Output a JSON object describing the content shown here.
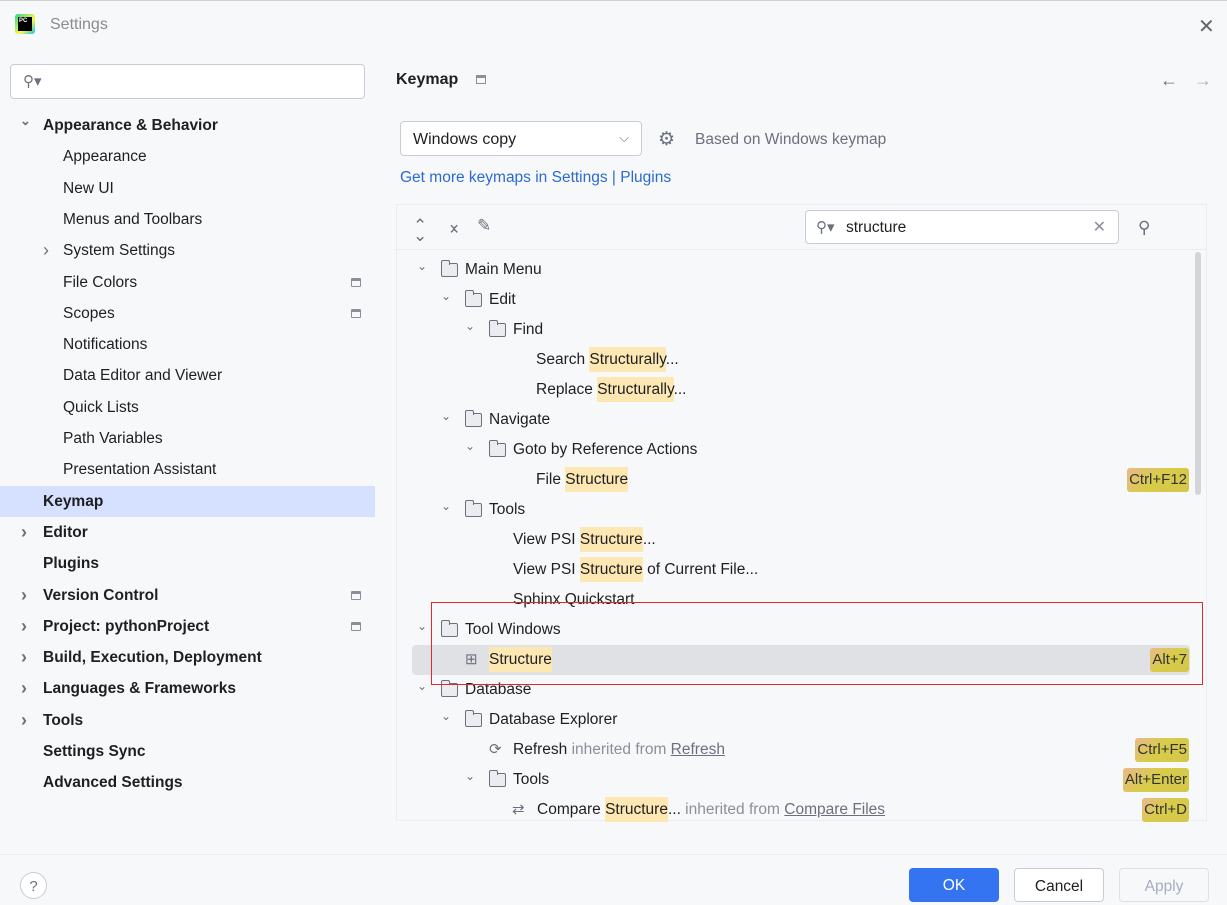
{
  "window": {
    "title": "Settings",
    "logo_text": "PC"
  },
  "sidebar": {
    "search_placeholder": "",
    "items": [
      {
        "label": "Appearance & Behavior",
        "level": 0,
        "bold": true,
        "chevron": "down"
      },
      {
        "label": "Appearance",
        "level": 1
      },
      {
        "label": "New UI",
        "level": 1
      },
      {
        "label": "Menus and Toolbars",
        "level": 1
      },
      {
        "label": "System Settings",
        "level": 1,
        "chevron": "right"
      },
      {
        "label": "File Colors",
        "level": 1,
        "pin": true
      },
      {
        "label": "Scopes",
        "level": 1,
        "pin": true
      },
      {
        "label": "Notifications",
        "level": 1
      },
      {
        "label": "Data Editor and Viewer",
        "level": 1
      },
      {
        "label": "Quick Lists",
        "level": 1
      },
      {
        "label": "Path Variables",
        "level": 1
      },
      {
        "label": "Presentation Assistant",
        "level": 1
      },
      {
        "label": "Keymap",
        "level": 0,
        "bold": true,
        "selected": true
      },
      {
        "label": "Editor",
        "level": 0,
        "bold": true,
        "chevron": "right"
      },
      {
        "label": "Plugins",
        "level": 0,
        "bold": true
      },
      {
        "label": "Version Control",
        "level": 0,
        "bold": true,
        "chevron": "right",
        "pin": true
      },
      {
        "label": "Project: pythonProject",
        "level": 0,
        "bold": true,
        "chevron": "right",
        "pin": true
      },
      {
        "label": "Build, Execution, Deployment",
        "level": 0,
        "bold": true,
        "chevron": "right"
      },
      {
        "label": "Languages & Frameworks",
        "level": 0,
        "bold": true,
        "chevron": "right"
      },
      {
        "label": "Tools",
        "level": 0,
        "bold": true,
        "chevron": "right"
      },
      {
        "label": "Settings Sync",
        "level": 0,
        "bold": true
      },
      {
        "label": "Advanced Settings",
        "level": 0,
        "bold": true
      }
    ]
  },
  "keymap": {
    "title": "Keymap",
    "selected_keymap": "Windows copy",
    "based_on": "Based on Windows keymap",
    "more_link": "Get more keymaps in Settings | Plugins",
    "filter_value": "structure",
    "icons": {
      "expand_all": "expand-all-icon",
      "collapse_all": "collapse-all-icon",
      "edit": "pencil-icon",
      "find_shortcut": "find-by-shortcut-icon"
    },
    "tree": [
      {
        "indent": 0,
        "chevron": true,
        "icon": "folder",
        "segments": [
          {
            "t": "Main Menu"
          }
        ]
      },
      {
        "indent": 1,
        "chevron": true,
        "icon": "folder",
        "segments": [
          {
            "t": "Edit"
          }
        ]
      },
      {
        "indent": 2,
        "chevron": true,
        "icon": "folder",
        "segments": [
          {
            "t": "Find"
          }
        ]
      },
      {
        "indent": 3,
        "icon": "none",
        "segments": [
          {
            "t": "Search "
          },
          {
            "t": "Structurally",
            "k": "hl"
          },
          {
            "t": "..."
          }
        ]
      },
      {
        "indent": 3,
        "icon": "none",
        "segments": [
          {
            "t": "Replace "
          },
          {
            "t": "Structurally",
            "k": "hl"
          },
          {
            "t": "..."
          }
        ]
      },
      {
        "indent": 1,
        "chevron": true,
        "icon": "folder",
        "segments": [
          {
            "t": "Navigate"
          }
        ]
      },
      {
        "indent": 2,
        "chevron": true,
        "icon": "folder",
        "segments": [
          {
            "t": "Goto by Reference Actions"
          }
        ]
      },
      {
        "indent": 3,
        "icon": "none",
        "segments": [
          {
            "t": "File "
          },
          {
            "t": "Structure",
            "k": "hl"
          }
        ],
        "shortcut": "Ctrl+F12"
      },
      {
        "indent": 1,
        "chevron": true,
        "icon": "folder",
        "segments": [
          {
            "t": "Tools"
          }
        ]
      },
      {
        "indent": 2,
        "icon": "none",
        "segments": [
          {
            "t": "View PSI "
          },
          {
            "t": "Structure",
            "k": "hl"
          },
          {
            "t": "..."
          }
        ]
      },
      {
        "indent": 2,
        "icon": "none",
        "segments": [
          {
            "t": "View PSI "
          },
          {
            "t": "Structure",
            "k": "hl"
          },
          {
            "t": " of Current File..."
          }
        ]
      },
      {
        "indent": 2,
        "icon": "none",
        "segments": [
          {
            "t": "Sphinx Quickstart"
          }
        ]
      },
      {
        "indent": 0,
        "chevron": true,
        "icon": "folder",
        "segments": [
          {
            "t": "Tool Windows"
          }
        ]
      },
      {
        "indent": 1,
        "icon": "structure",
        "selected": true,
        "segments": [
          {
            "t": "Structure",
            "k": "hl"
          }
        ],
        "shortcut": "Alt+7"
      },
      {
        "indent": 0,
        "chevron": true,
        "icon": "folder",
        "segments": [
          {
            "t": "Database"
          }
        ]
      },
      {
        "indent": 1,
        "chevron": true,
        "icon": "folder",
        "segments": [
          {
            "t": "Database Explorer"
          }
        ]
      },
      {
        "indent": 2,
        "icon": "refresh",
        "segments": [
          {
            "t": "Refresh"
          },
          {
            "t": " inherited from ",
            "k": "muted"
          },
          {
            "t": "Refresh",
            "k": "link"
          }
        ],
        "shortcut": "Ctrl+F5"
      },
      {
        "indent": 2,
        "chevron": true,
        "icon": "folder",
        "segments": [
          {
            "t": "Tools"
          }
        ],
        "shortcut": "Alt+Enter"
      },
      {
        "indent": 3,
        "icon": "compare",
        "segments": [
          {
            "t": "Compare "
          },
          {
            "t": "Structure",
            "k": "hl"
          },
          {
            "t": "..."
          },
          {
            "t": " inherited from ",
            "k": "muted"
          },
          {
            "t": "Compare Files",
            "k": "link"
          }
        ],
        "shortcut": "Ctrl+D"
      }
    ]
  },
  "footer": {
    "help": "?",
    "ok": "OK",
    "cancel": "Cancel",
    "apply": "Apply"
  },
  "colors": {
    "accent": "#3574f0",
    "selection": "#d5e1ff",
    "highlight": "#fde8b4",
    "annotation_box": "#e0282e"
  }
}
